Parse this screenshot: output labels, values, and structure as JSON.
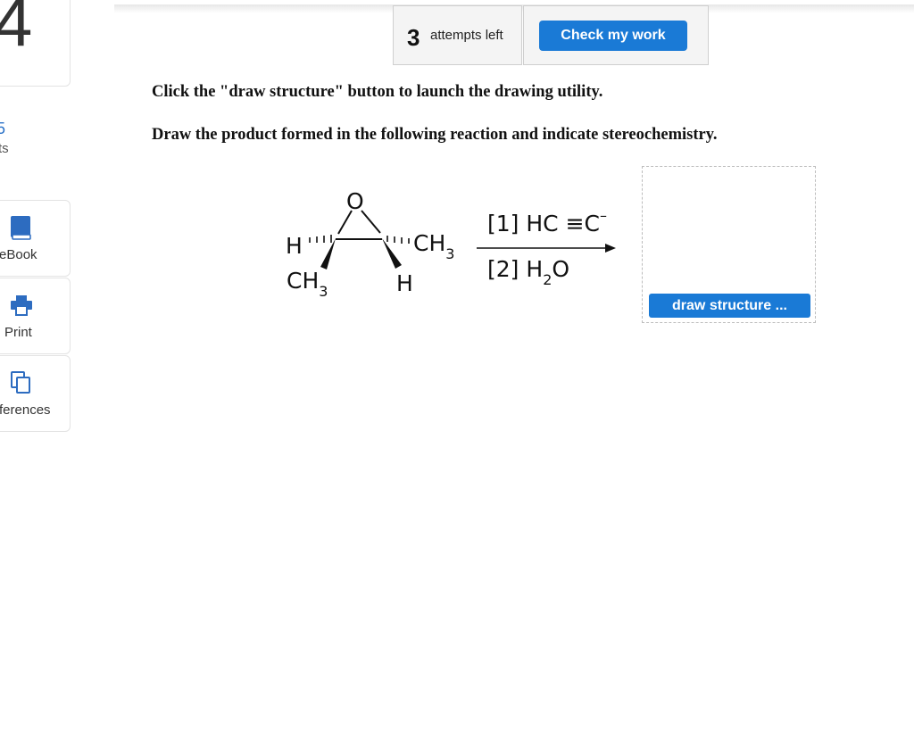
{
  "sidebar": {
    "question_number": "4",
    "points_value": "5",
    "points_label": "ts",
    "items": [
      {
        "label": "eBook",
        "icon": "book-icon"
      },
      {
        "label": "Print",
        "icon": "printer-icon"
      },
      {
        "label": "ferences",
        "icon": "copy-icon"
      }
    ]
  },
  "header": {
    "attempts_count": "3",
    "attempts_text": "attempts left",
    "check_label": "Check my work"
  },
  "question": {
    "line1": "Click the \"draw structure\" button to launch the drawing utility.",
    "line2": "Draw the product formed in the following reaction and indicate stereochemistry."
  },
  "reaction": {
    "oxygen": "O",
    "left_h": "H",
    "left_ch": "CH",
    "left_ch_sub": "3",
    "right_ch": "CH",
    "right_ch_sub": "3",
    "right_h": "H",
    "step1_prefix": "[1]",
    "step1_reagent": "HC ≡C",
    "step1_charge": "–",
    "step2_prefix": "[2]",
    "step2_h": "H",
    "step2_sub": "2",
    "step2_o": "O"
  },
  "answer": {
    "draw_label": "draw structure ..."
  },
  "colors": {
    "accent": "#1a7ad6",
    "link": "#2b72c8"
  }
}
